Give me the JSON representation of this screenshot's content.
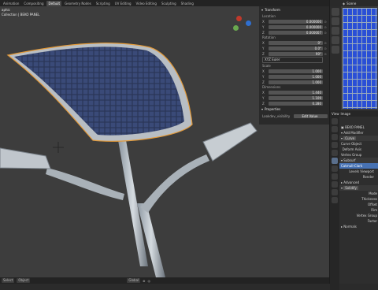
{
  "workspaces": [
    "Animation",
    "Compositing",
    "Default",
    "Geometry Nodes",
    "Scripting",
    "UV Editing",
    "Video Editing",
    "Sculpting",
    "Shading"
  ],
  "active_workspace": "Default",
  "viewport": {
    "line1": "aphic",
    "line2": "Collection | BEKO PANEL"
  },
  "npanel": {
    "transform_title": "Transform",
    "location_label": "Location",
    "location": {
      "x": "0.000000",
      "y": "0.000000",
      "z": "0.000007"
    },
    "rotation_label": "Rotation",
    "rotation": {
      "x": "0°",
      "y": "0.0°",
      "z": "90°"
    },
    "rotation_mode": "XYZ Euler",
    "scale_label": "Scale",
    "scale": {
      "x": "1.000",
      "y": "1.000",
      "z": "1.000"
    },
    "dimensions_label": "Dimensions",
    "dimensions": {
      "x": "1.440",
      "y": "1.109",
      "z": "0.280"
    },
    "properties_title": "Properties",
    "lookdev_label": "Lookdev_visibility",
    "lookdev_value": "Edit Value"
  },
  "right_header": {
    "mode": "View",
    "image": "Image",
    "scene": "Scene"
  },
  "props": {
    "object_name": "BEKO PANEL",
    "add_modifier": "Add Modifier",
    "curve_mod": "Curve",
    "curve_object": "Curve Object",
    "deform_axis": "Deform Axis",
    "vertex_group": "Vertex Group",
    "uvwarp": "Subsurf",
    "subdiv_type": "Catmull-Clark",
    "levels_viewport": "Levels Viewport",
    "render": "Render",
    "advanced": "Advanced",
    "solidify": "Solidify",
    "mode": "Mode",
    "thickness": "Thickness",
    "offset": "Offset",
    "rim": "Rim",
    "vertex_group2": "Vertex Group",
    "factor": "Factor",
    "normals": "Normals"
  },
  "statusbar": {
    "select": "Select",
    "object": "Object",
    "orientation": "Global"
  }
}
